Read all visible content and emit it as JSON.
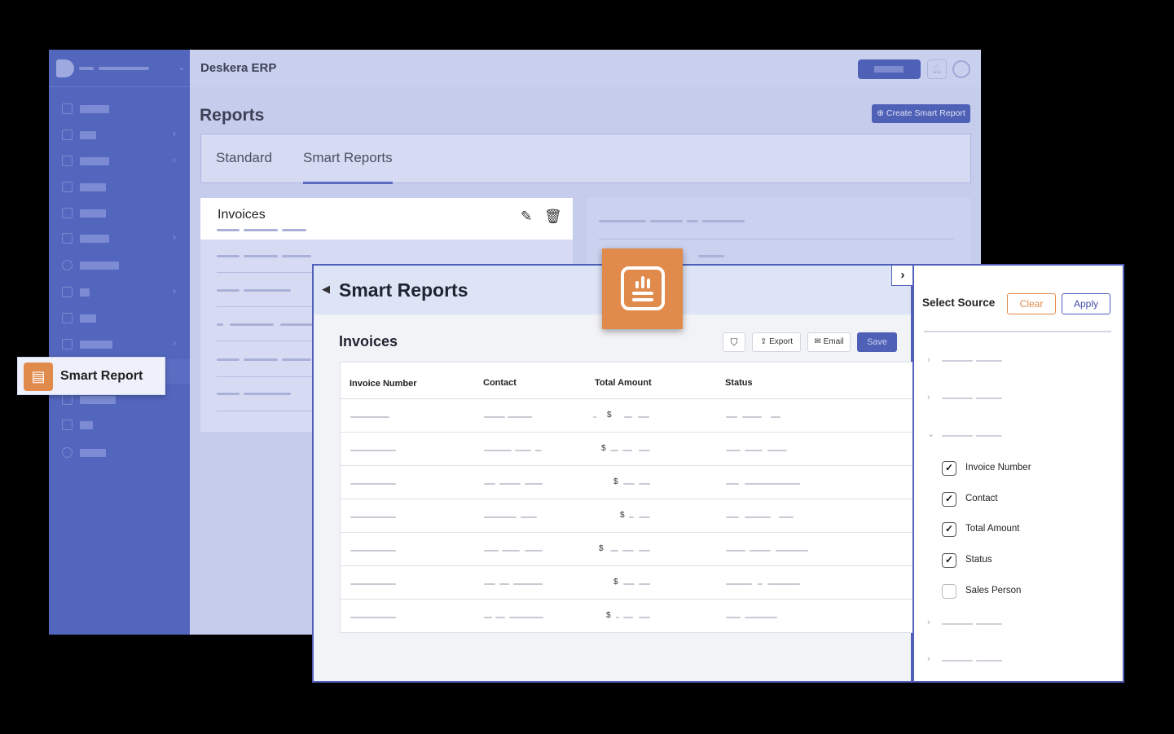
{
  "app": {
    "title": "Deskera ERP"
  },
  "page": {
    "title": "Reports",
    "create_button": "⊕ Create Smart Report"
  },
  "tabs": [
    {
      "label": "Standard"
    },
    {
      "label": "Smart Reports"
    }
  ],
  "invoice_card": {
    "title": "Invoices"
  },
  "floating_label": {
    "text": "Smart Report"
  },
  "smart_reports": {
    "title": "Smart Reports",
    "subtitle": "Invoices",
    "toolbar": {
      "export": "Export",
      "email": "Email",
      "save": "Save"
    },
    "table": {
      "headers": [
        "Invoice Number",
        "Contact",
        "Total Amount",
        "Status"
      ],
      "currency_symbol": "$",
      "row_count": 7
    }
  },
  "select_source": {
    "title": "Select Source",
    "clear": "Clear",
    "apply": "Apply",
    "fields": [
      {
        "label": "Invoice Number",
        "checked": true
      },
      {
        "label": "Contact",
        "checked": true
      },
      {
        "label": "Total Amount",
        "checked": true
      },
      {
        "label": "Status",
        "checked": true
      },
      {
        "label": "Sales Person",
        "checked": false
      }
    ]
  },
  "colors": {
    "brand": "#5366bd",
    "accent": "#e08a4c",
    "primary_button": "#4f60b7"
  }
}
